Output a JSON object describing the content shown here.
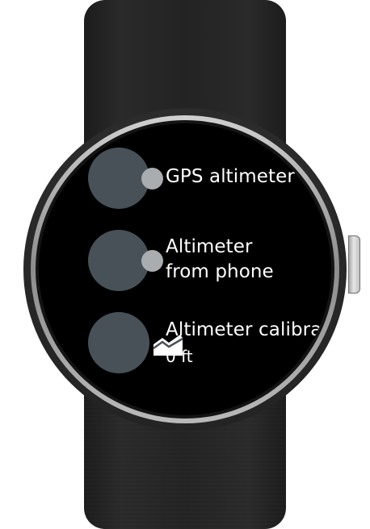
{
  "settings_list": {
    "items": [
      {
        "label": "GPS altimeter",
        "icon": "toggle-off-icon"
      },
      {
        "label_line1": "Altimeter",
        "label_line2": "from phone",
        "icon": "toggle-off-icon"
      },
      {
        "label": "Altimeter calibration",
        "value": "0 ft",
        "icon": "calibration-chart-icon"
      }
    ]
  },
  "colors": {
    "screen_background": "#000000",
    "icon_circle": "#475157",
    "toggle_knob": "#a9adb0",
    "text": "#ffffff"
  }
}
